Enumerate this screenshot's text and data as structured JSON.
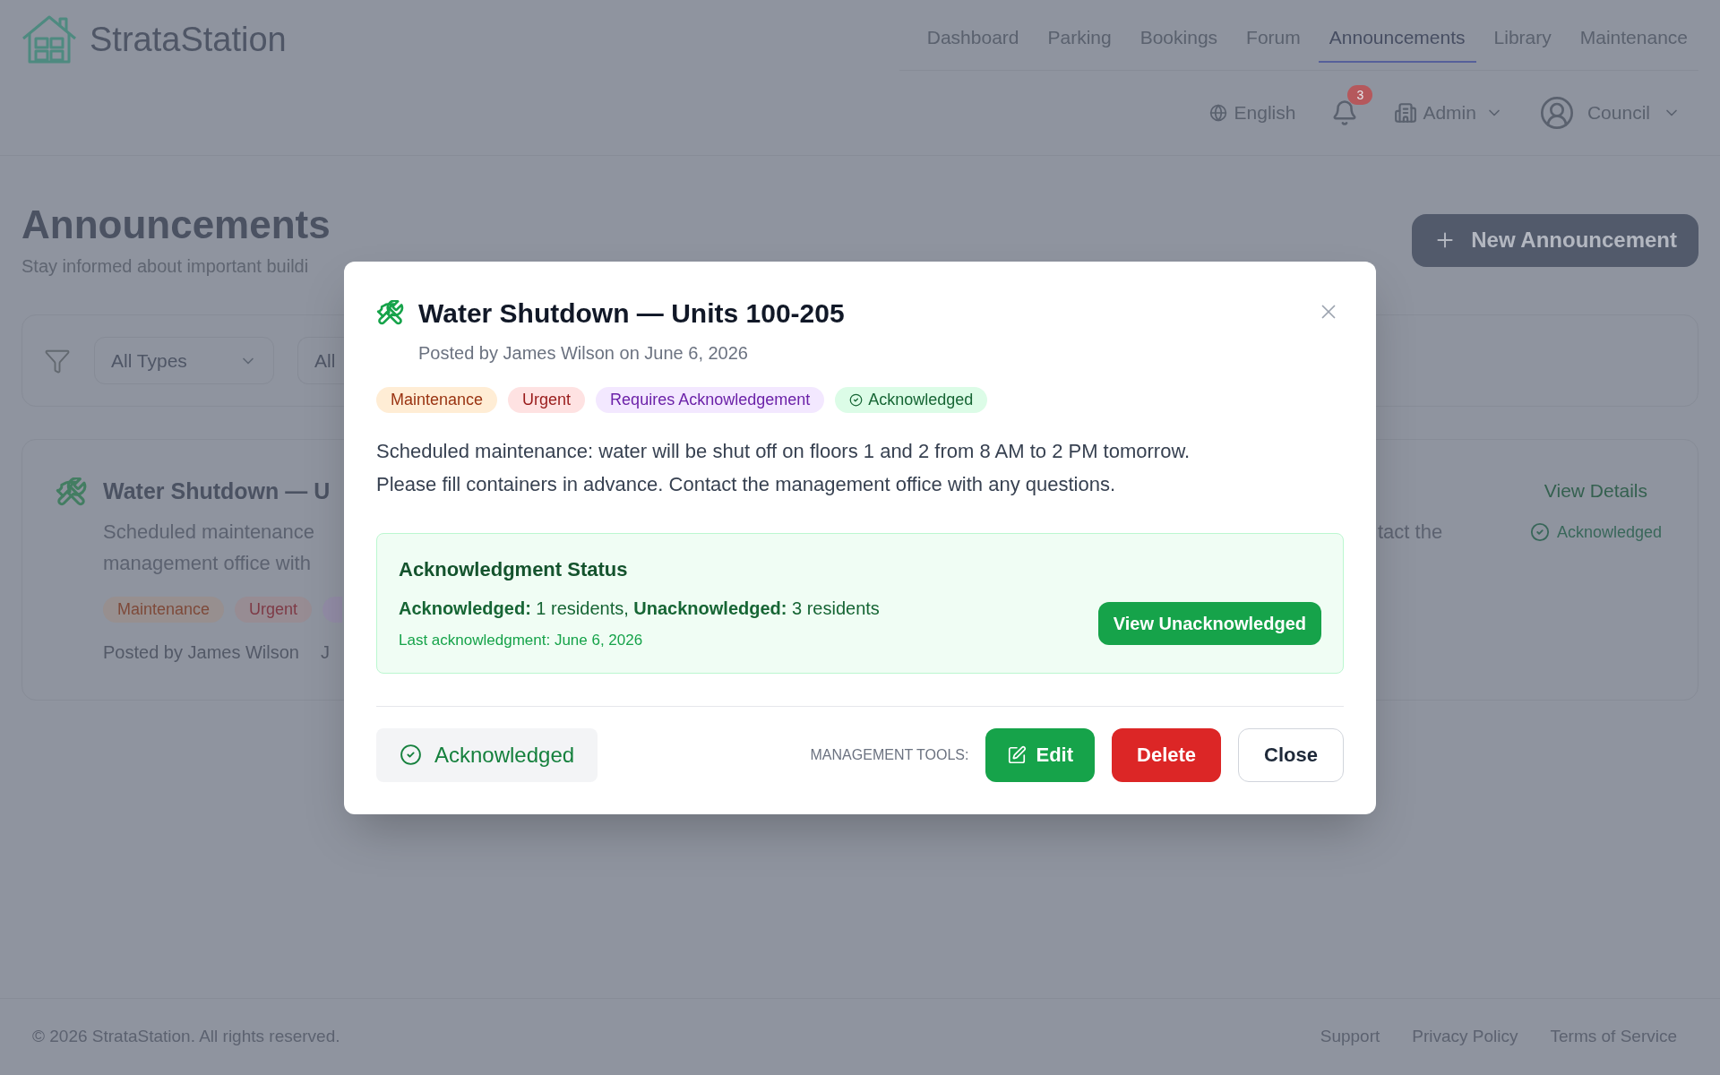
{
  "header": {
    "logo_text": "StrataStation",
    "nav": [
      {
        "label": "Dashboard",
        "selected": false
      },
      {
        "label": "Parking",
        "selected": false
      },
      {
        "label": "Bookings",
        "selected": false
      },
      {
        "label": "Forum",
        "selected": false
      },
      {
        "label": "Announcements",
        "selected": true
      },
      {
        "label": "Library",
        "selected": false
      },
      {
        "label": "Maintenance",
        "selected": false
      }
    ],
    "language": "English",
    "notification_count": "3",
    "role_menu": "Admin",
    "user_menu": "Council"
  },
  "page": {
    "title": "Announcements",
    "subtitle": "Stay informed about important buildi",
    "new_button": "New Announcement"
  },
  "filters": [
    {
      "kind": "select",
      "value": "All Types"
    },
    {
      "kind": "select_cut",
      "value": "All"
    }
  ],
  "announcement_card": {
    "title": "Water Shutdown — U",
    "description": "Scheduled maintenance\nmanagement office with",
    "description_right": "tact the",
    "tags": [
      {
        "kind": "maintenance",
        "label": "Maintenance"
      },
      {
        "kind": "urgent",
        "label": "Urgent"
      },
      {
        "kind": "requires_ack"
      }
    ],
    "posted_by": "Posted by James Wilson",
    "meta_2": "J",
    "link": "View Details",
    "status": {
      "label": "Acknowledged",
      "acknowledged": true
    }
  },
  "modal": {
    "title": "Water Shutdown — Units 100-205",
    "meta": "Posted by James Wilson on June 6, 2026",
    "tags": [
      {
        "kind": "maintenance",
        "label": "Maintenance"
      },
      {
        "kind": "urgent",
        "label": "Urgent"
      },
      {
        "kind": "requires_ack",
        "label": "Requires Acknowledgement"
      },
      {
        "kind": "acknowledged",
        "label": "Acknowledged"
      }
    ],
    "body": "Scheduled maintenance: water will be shut off on floors 1 and 2 from 8 AM to 2 PM tomorrow.\nPlease fill containers in advance. Contact the management office with any questions.",
    "ack_status": {
      "heading": "Acknowledgment Status",
      "summary": "**Acknowledged:** 1 residents, **Unacknowledged:** 3 residents",
      "last": "Last acknowledgment: June 6, 2026",
      "button": "View Unacknowledged"
    },
    "user_ack": {
      "label": "Acknowledged",
      "acknowledged": true
    },
    "tools_label": "MANAGEMENT TOOLS:",
    "buttons": [
      {
        "kind": "edit",
        "label": "Edit"
      },
      {
        "kind": "delete",
        "label": "Delete"
      },
      {
        "kind": "close",
        "label": "Close"
      }
    ]
  },
  "footer": {
    "copyright": "© 2026 StrataStation. All rights reserved.",
    "links": [
      "Support",
      "Privacy Policy",
      "Terms of Service"
    ]
  }
}
